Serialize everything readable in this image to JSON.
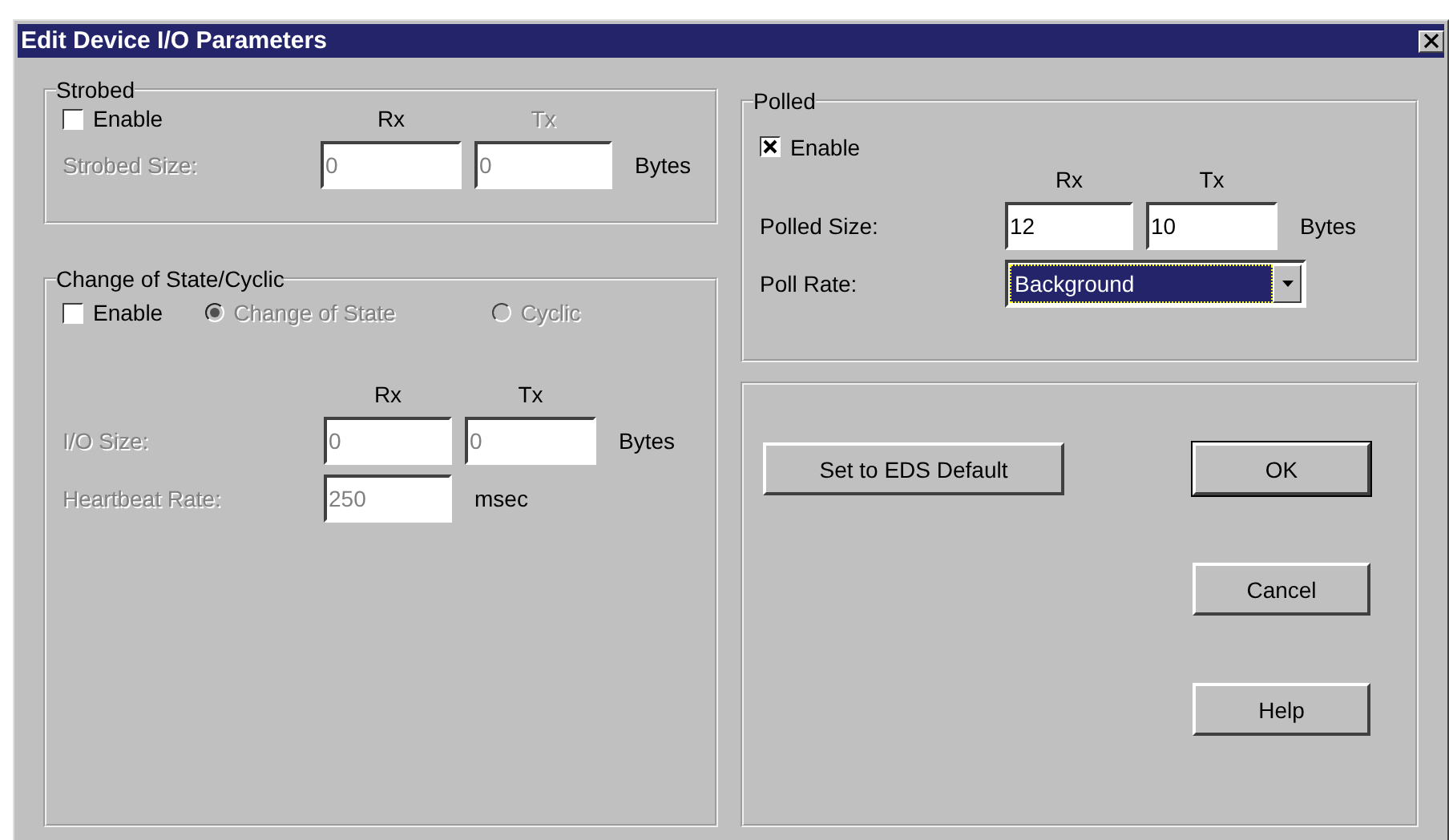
{
  "window": {
    "title": "Edit Device I/O Parameters"
  },
  "strobed": {
    "title": "Strobed",
    "enable": {
      "label": "Enable",
      "checked": false
    },
    "headers": [
      {
        "text": "Rx",
        "disabled": false
      },
      {
        "text": "Tx",
        "disabled": true
      }
    ],
    "rows": [
      {
        "label": "Strobed Size:",
        "disabled": true,
        "fields": [
          {
            "value": "0",
            "disabled": true
          },
          {
            "value": "0",
            "disabled": true
          }
        ],
        "unit": "Bytes"
      }
    ]
  },
  "change_of_state": {
    "title": "Change of State/Cyclic",
    "enable": {
      "label": "Enable",
      "checked": false
    },
    "modes": [
      {
        "label": "Change of State",
        "selected": true,
        "disabled": true
      },
      {
        "label": "Cyclic",
        "selected": false,
        "disabled": true
      }
    ],
    "headers": [
      {
        "text": "Rx",
        "disabled": false
      },
      {
        "text": "Tx",
        "disabled": false
      }
    ],
    "rows": [
      {
        "label": "I/O Size:",
        "disabled": true,
        "fields": [
          {
            "value": "0",
            "disabled": true
          },
          {
            "value": "0",
            "disabled": true
          }
        ],
        "unit": "Bytes"
      },
      {
        "label": "Heartbeat Rate:",
        "disabled": true,
        "fields": [
          {
            "value": "250",
            "disabled": true
          }
        ],
        "unit": "msec"
      }
    ]
  },
  "polled": {
    "title": "Polled",
    "enable": {
      "label": "Enable",
      "checked": true
    },
    "headers": [
      {
        "text": "Rx",
        "disabled": false
      },
      {
        "text": "Tx",
        "disabled": false
      }
    ],
    "rows": [
      {
        "label": "Polled Size:",
        "disabled": false,
        "fields": [
          {
            "value": "12",
            "disabled": false
          },
          {
            "value": "10",
            "disabled": false
          }
        ],
        "unit": "Bytes"
      }
    ],
    "poll_rate": {
      "label": "Poll Rate:",
      "value": "Background"
    }
  },
  "buttons": [
    {
      "label": "Set to EDS Default",
      "kind": "wide",
      "default": false
    },
    {
      "label": "OK",
      "kind": "action",
      "default": true
    },
    {
      "label": "Cancel",
      "kind": "action",
      "default": false
    },
    {
      "label": "Help",
      "kind": "action",
      "default": false
    }
  ]
}
